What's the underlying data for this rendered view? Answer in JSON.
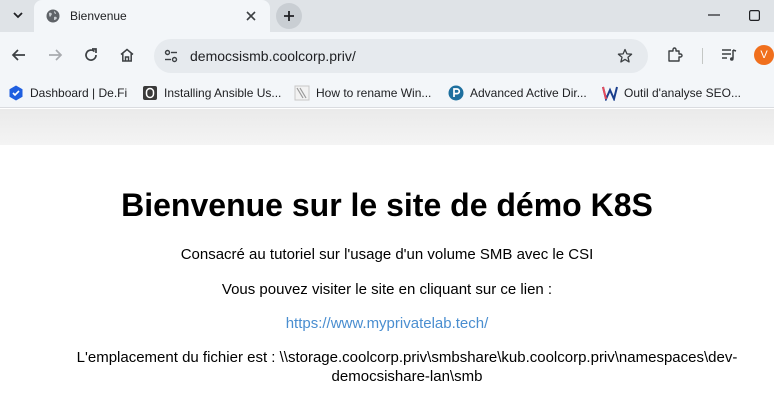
{
  "tab": {
    "title": "Bienvenue"
  },
  "address_bar": {
    "url": "democsismb.coolcorp.priv/"
  },
  "avatar": {
    "initial": "V",
    "color": "#f06f1d"
  },
  "bookmarks": [
    {
      "label": "Dashboard | De.Fi",
      "icon": "defi-logo-icon"
    },
    {
      "label": "Installing Ansible Us...",
      "icon": "ansible-docs-icon"
    },
    {
      "label": "How to rename Win...",
      "icon": "page-icon"
    },
    {
      "label": "Advanced Active Dir...",
      "icon": "p-logo-icon"
    },
    {
      "label": "Outil d'analyse SEO...",
      "icon": "w-logo-icon"
    }
  ],
  "page": {
    "heading": "Bienvenue sur le site de démo K8S",
    "subtitle": "Consacré au tutoriel sur l'usage d'un volume SMB avec le CSI",
    "visit_text": "Vous pouvez visiter le site en cliquant sur ce lien :",
    "link": "https://www.myprivatelab.tech/",
    "file_location": "L'emplacement du fichier est : \\\\storage.coolcorp.priv\\smbshare\\kub.coolcorp.priv\\namespaces\\dev-democsishare-lan\\smb"
  },
  "colors": {
    "link": "#4a8ed0",
    "tab_strip": "#dfe3e7",
    "toolbar": "#f3f6f9"
  }
}
